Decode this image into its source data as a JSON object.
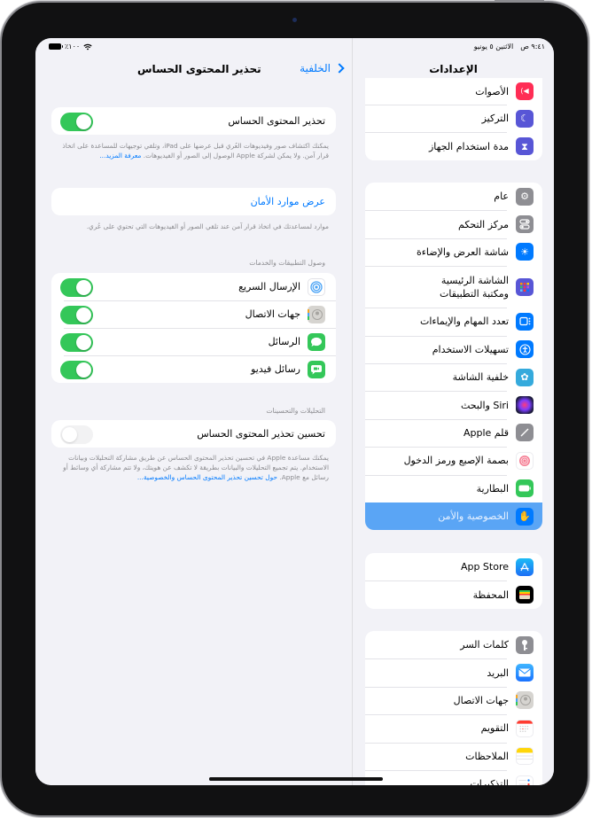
{
  "status_bar": {
    "time": "٩:٤١ ص",
    "date": "الاثنين ٥ يونيو",
    "battery": "٪١٠٠"
  },
  "sidebar": {
    "title": "الإعدادات",
    "groups": [
      {
        "items": [
          {
            "label": "الأصوات",
            "icon": "sounds-icon",
            "color": "#ff2d55"
          },
          {
            "label": "التركيز",
            "icon": "focus-moon-icon",
            "color": "#5856d6"
          },
          {
            "label": "مدة استخدام الجهاز",
            "icon": "screen-time-hourglass-icon",
            "color": "#5856d6"
          }
        ]
      },
      {
        "items": [
          {
            "label": "عام",
            "icon": "general-gear-icon",
            "color": "#8e8e93"
          },
          {
            "label": "مركز التحكم",
            "icon": "control-center-icon",
            "color": "#8e8e93"
          },
          {
            "label": "شاشة العرض والإضاءة",
            "icon": "display-brightness-icon",
            "color": "#007aff"
          },
          {
            "label": "الشاشة الرئيسية ومكتبة التطبيقات",
            "icon": "home-screen-grid-icon",
            "color": "#5856d6"
          },
          {
            "label": "تعدد المهام والإيماءات",
            "icon": "multitasking-icon",
            "color": "#007aff"
          },
          {
            "label": "تسهيلات الاستخدام",
            "icon": "accessibility-icon",
            "color": "#007aff"
          },
          {
            "label": "خلفية الشاشة",
            "icon": "wallpaper-flower-icon",
            "color": "#35aadc"
          },
          {
            "label": "Siri والبحث",
            "icon": "siri-icon",
            "color": "#1c1c3a"
          },
          {
            "label": "قلم Apple",
            "icon": "apple-pencil-icon",
            "color": "#8e8e93"
          },
          {
            "label": "بصمة الإصبع ورمز الدخول",
            "icon": "touch-id-fingerprint-icon",
            "color": "#ffffff"
          },
          {
            "label": "البطارية",
            "icon": "battery-icon",
            "color": "#34c759"
          },
          {
            "label": "الخصوصية والأمن",
            "icon": "privacy-hand-icon",
            "color": "#007aff",
            "selected": true
          }
        ]
      },
      {
        "items": [
          {
            "label": "App Store",
            "icon": "app-store-icon",
            "color": "#1c8cf5"
          },
          {
            "label": "المحفظة",
            "icon": "wallet-icon",
            "color": "#000000"
          }
        ]
      },
      {
        "items": [
          {
            "label": "كلمات السر",
            "icon": "passwords-key-icon",
            "color": "#8e8e93"
          },
          {
            "label": "البريد",
            "icon": "mail-icon",
            "color": "#1a8cff"
          },
          {
            "label": "جهات الاتصال",
            "icon": "contacts-icon",
            "color": "#d6d4d0"
          },
          {
            "label": "التقويم",
            "icon": "calendar-icon",
            "color": "#ffffff"
          },
          {
            "label": "الملاحظات",
            "icon": "notes-icon",
            "color": "#ffffff"
          },
          {
            "label": "التذكيرات",
            "icon": "reminders-icon",
            "color": "#ffffff"
          }
        ]
      }
    ]
  },
  "detail": {
    "back_label": "الخلفية",
    "title": "تحذير المحتوى الحساس",
    "main_toggle": {
      "label": "تحذير المحتوى الحساس",
      "on": true
    },
    "main_footnote": "يمكنك اكتشاف صور وفيديوهات العُري قبل عرضها على iPad، وتلقي توجيهات للمساعدة على اتخاذ قرار آمن. ولا يمكن لشركة Apple الوصول إلى الصور أو الفيديوهات.",
    "main_footnote_link": "معرفة المزيد...",
    "resources_link": "عرض موارد الأمان",
    "resources_footnote": "موارد لمساعدتك في اتخاذ قرار آمن عند تلقي الصور أو الفيديوهات التي تحتوي على عُري.",
    "apps_header": "وصول التطبيقات والخدمات",
    "apps": [
      {
        "label": "الإرسال السريع",
        "icon": "airdrop-icon",
        "on": true
      },
      {
        "label": "جهات الاتصال",
        "icon": "contacts-icon",
        "on": true
      },
      {
        "label": "الرسائل",
        "icon": "messages-icon",
        "on": true
      },
      {
        "label": "رسائل فيديو",
        "icon": "video-messages-icon",
        "on": true
      }
    ],
    "analytics_header": "التحليلات والتحسينات",
    "improve_toggle": {
      "label": "تحسين تحذير المحتوى الحساس",
      "on": false
    },
    "improve_footnote": "يمكنك مساعدة Apple في تحسين تحذير المحتوى الحساس عن طريق مشاركة التحليلات وبيانات الاستخدام. يتم تجميع التحليلات والبيانات بطريقة لا تكشف عن هويتك، ولا تتم مشاركة أي وسائط أو رسائل مع Apple.",
    "improve_footnote_link": "حول تحسين تحذير المحتوى الحساس والخصوصية..."
  },
  "colors": {
    "accent": "#007aff",
    "toggle_on": "#34c759",
    "selected_row": "#5aa5f5"
  }
}
